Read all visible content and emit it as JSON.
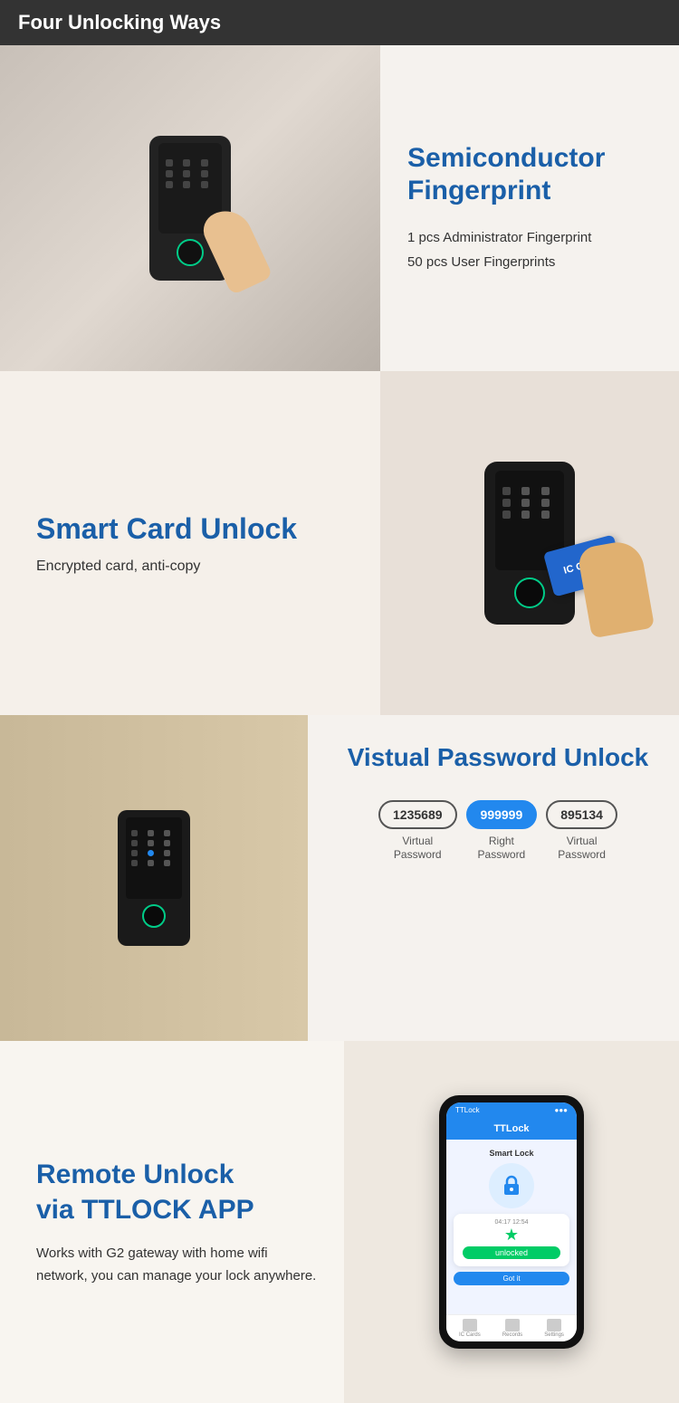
{
  "header": {
    "title": "Four Unlocking Ways"
  },
  "section1": {
    "title": "Semiconductor Fingerprint",
    "line1": "1 pcs Administrator Fingerprint",
    "line2": "50 pcs User Fingerprints"
  },
  "section2": {
    "title": "Smart Card Unlock",
    "subtitle": "Encrypted card, anti-copy",
    "card_label": "IC CARD"
  },
  "section3": {
    "title": "Vistual Password Unlock",
    "badges": [
      {
        "value": "1235689",
        "style": "outline",
        "label1": "Virtual",
        "label2": "Password"
      },
      {
        "value": "999999",
        "style": "filled",
        "label1": "Right",
        "label2": "Password"
      },
      {
        "value": "895134",
        "style": "outline",
        "label1": "Virtual",
        "label2": "Password"
      }
    ]
  },
  "section4": {
    "title": "Remote Unlock\nvia TTLOCK APP",
    "description": "Works with G2 gateway with home wifi network, you can manage your lock anywhere.",
    "phone": {
      "app_name": "TTLock",
      "lock_name": "Smart Lock",
      "time": "04:17 12:54",
      "status": "unlocked",
      "got_it": "Got it",
      "nav_items": [
        "IC Cards",
        "Records",
        "Settings"
      ]
    }
  }
}
